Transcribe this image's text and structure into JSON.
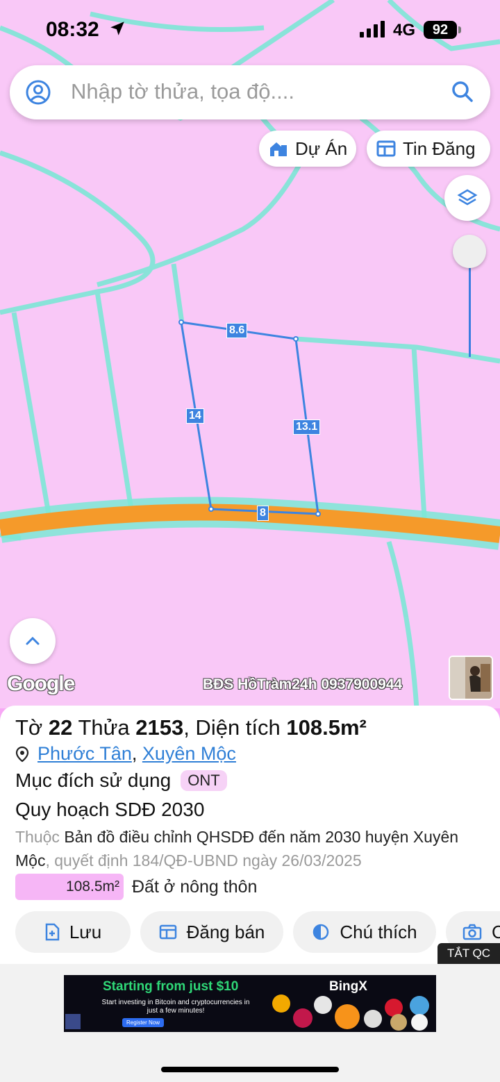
{
  "status_bar": {
    "time": "08:32",
    "network": "4G",
    "battery": "92"
  },
  "search": {
    "placeholder": "Nhập tờ thửa, tọa độ...."
  },
  "chips": {
    "du_an": "Dự Án",
    "tin_dang": "Tin Đăng"
  },
  "map": {
    "edges": {
      "top": "8.6",
      "left": "14",
      "right": "13.1",
      "bottom": "8"
    },
    "provider": "Google",
    "watermark": "BĐS HồTràm24h 0937900944"
  },
  "parcel": {
    "to_label": "Tờ",
    "to": "22",
    "thua_label": "Thửa",
    "thua": "2153",
    "dien_tich_label": ", Diện tích",
    "dien_tich": "108.5m²",
    "commune": "Phước Tân",
    "district": "Xuyên Mộc",
    "purpose_label": "Mục đích sử dụng",
    "purpose_code": "ONT",
    "plan_title": "Quy hoạch SDĐ 2030",
    "plan_prefix": "Thuộc",
    "plan_doc": "Bản đồ điều chỉnh QHSDĐ đến năm 2030 huyện Xuyên Mộc",
    "plan_decision": ", quyết định 184/QĐ-UBND ngày 26/03/2025",
    "area_value": "108.5m²",
    "area_type": "Đất ở nông thôn"
  },
  "actions": {
    "save": "Lưu",
    "post": "Đăng bán",
    "legend": "Chú thích",
    "photo": "C"
  },
  "ads": {
    "close_label": "TẮT QC",
    "headline": "Starting from just $10",
    "subtext": "Start investing in Bitcoin and cryptocurrencies in just a few minutes!",
    "cta": "Register Now",
    "brand": "BingX"
  },
  "colors": {
    "accent": "#3d84e0",
    "map_bg": "#f9c8f7",
    "road": "#f59a2a",
    "boundary": "#7de7d6",
    "ont_fill": "#f6b6f6"
  }
}
